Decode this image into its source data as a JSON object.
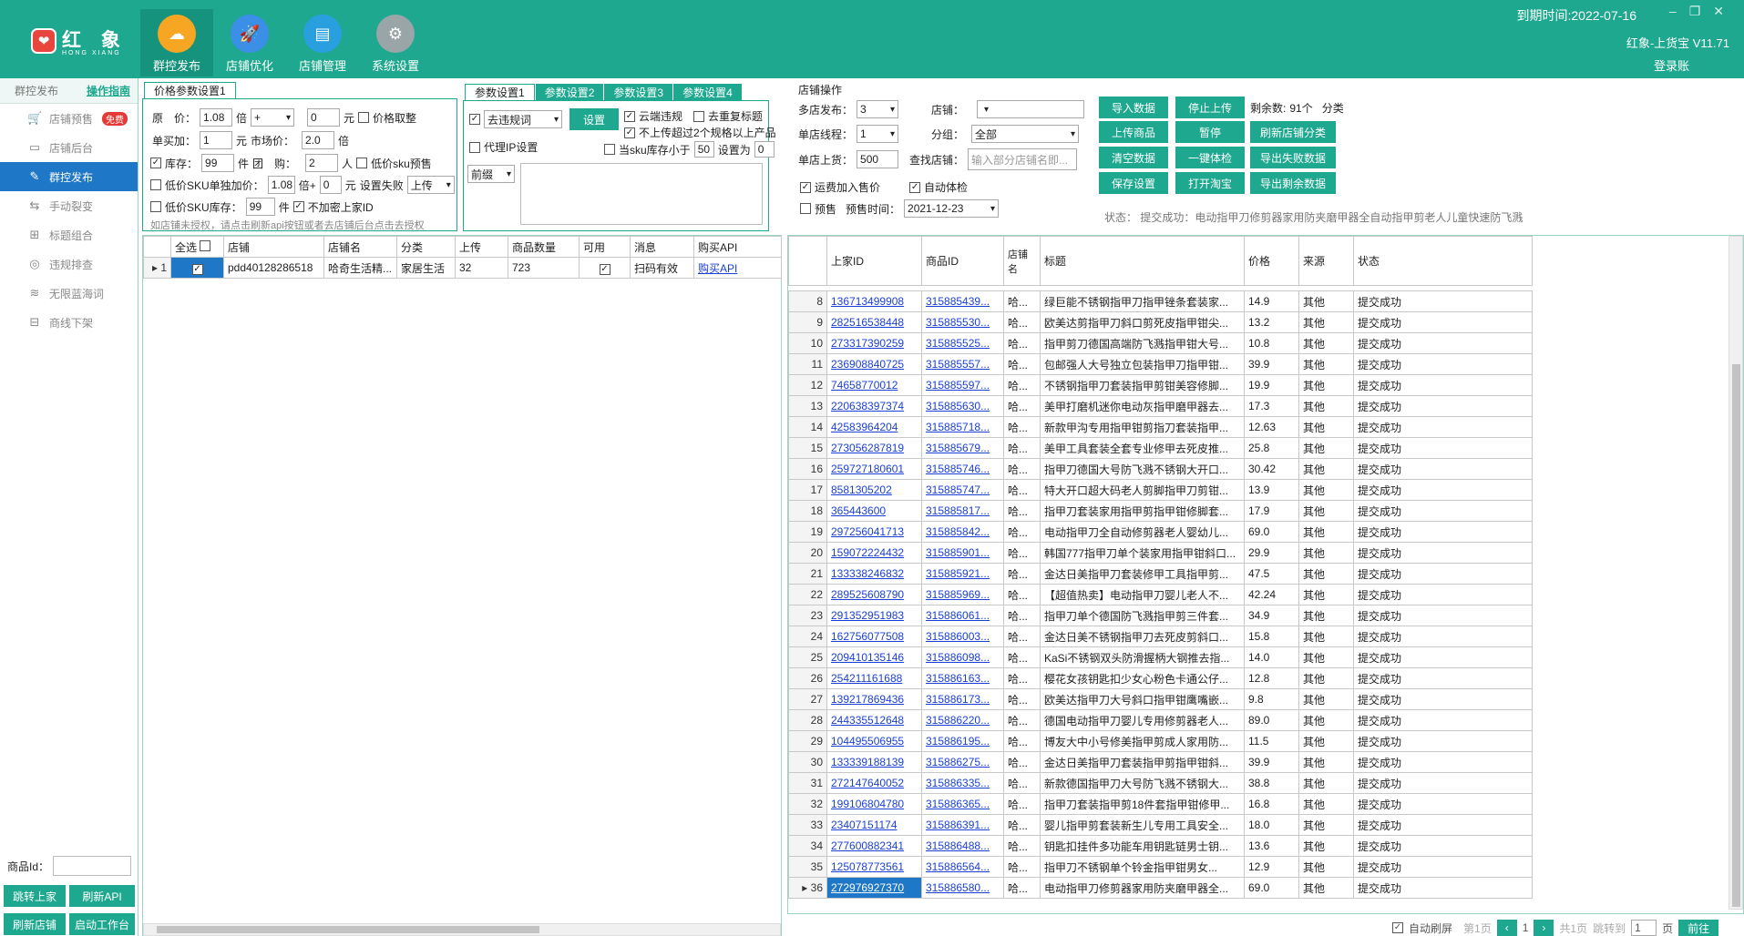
{
  "app": {
    "logo_mark": "❤",
    "logo_text": "红 象",
    "logo_sub": "HONG XIANG",
    "expire": "到期时间:2022-07-16",
    "version": "红象-上货宝 V11.71",
    "login": "登录账"
  },
  "nav": [
    {
      "label": "群控发布",
      "icon": "☁"
    },
    {
      "label": "店铺优化",
      "icon": "🚀"
    },
    {
      "label": "店铺管理",
      "icon": "▤"
    },
    {
      "label": "系统设置",
      "icon": "⚙"
    }
  ],
  "sidebar": {
    "title": "群控发布",
    "guide": "操作指南",
    "items": [
      {
        "label": "店铺预售",
        "icon": "🛒",
        "badge": "免费"
      },
      {
        "label": "店铺后台",
        "icon": "▭"
      },
      {
        "label": "群控发布",
        "icon": "✎"
      },
      {
        "label": "手动裂变",
        "icon": "⇆"
      },
      {
        "label": "标题组合",
        "icon": "⊞"
      },
      {
        "label": "违规排查",
        "icon": "◎"
      },
      {
        "label": "无限蓝海词",
        "icon": "≋"
      },
      {
        "label": "商线下架",
        "icon": "⊟"
      }
    ],
    "pid_label": "商品Id：",
    "btns": [
      "跳转上家",
      "刷新API",
      "刷新店铺",
      "启动工作台"
    ]
  },
  "price": {
    "tab": "价格参数设置1",
    "orig_label": "原　价：",
    "orig": "1.08",
    "bei": "倍",
    "op": "+",
    "add": "0",
    "yuan": "元",
    "round": "价格取整",
    "buy_label": "单买加：",
    "buy": "1",
    "yuan2": "元",
    "market_label": "市场价：",
    "market": "2.0",
    "bei2": "倍",
    "stock_label": "库存：",
    "stock": "99",
    "jian": "件",
    "group_label": "团　购：",
    "group": "2",
    "ren": "人",
    "low_sku": "低价sku预售",
    "low_add_label": "低价SKU单独加价：",
    "low_add": "1.08",
    "bei3": "倍+",
    "low_add2": "0",
    "yuan3": "元",
    "fail_label": "设置失败",
    "fail_val": "上传",
    "low_stock_label": "低价SKU库存：",
    "low_stock": "99",
    "jian2": "件",
    "noencrypt": "不加密上家ID",
    "note": "如店铺未授权，请点击刷新api按钮或者去店铺后台点击去授权"
  },
  "params": {
    "tabs": [
      "参数设置1",
      "参数设置2",
      "参数设置3",
      "参数设置4"
    ],
    "rule": "去违规词",
    "set": "设置",
    "cloud": "云端违规",
    "dedupe": "去重复标题",
    "no_spec": "不上传超过2个规格以上产品",
    "proxy": "代理IP设置",
    "sku_lt": "当sku库存小于",
    "sku_n": "50",
    "set_to": "设置为",
    "set_n": "0",
    "prefix": "前缀"
  },
  "shopop": {
    "title": "店铺操作",
    "multi_label": "多店发布：",
    "multi": "3",
    "shop_label": "店铺：",
    "shop": "",
    "thread_label": "单店线程：",
    "thread": "1",
    "group_label": "分组：",
    "group": "全部",
    "goods_label": "单店上货：",
    "goods": "500",
    "find_label": "查找店铺：",
    "find_ph": "输入部分店铺名即...",
    "freight": "运费加入售价",
    "autocheck": "自动体检",
    "presale": "预售",
    "presale_time_label": "预售时间：",
    "presale_time": "2021-12-23",
    "btns": [
      "导入数据",
      "上传商品",
      "清空数据",
      "保存设置",
      "停止上传",
      "暂停",
      "一键体检",
      "打开淘宝",
      "刷新店铺分类",
      "导出失败数据",
      "导出剩余数据"
    ],
    "remain_label": "剩余数:",
    "remain": "91个",
    "fen": "分类",
    "status": "状态：  提交成功：电动指甲刀修剪器家用防夹磨甲器全自动指甲剪老人儿童快速防飞溅"
  },
  "shoptable": {
    "headers": [
      "全选",
      "店铺",
      "店铺名",
      "分类",
      "上传",
      "商品数量",
      "可用",
      "消息",
      "购买API"
    ],
    "rows": [
      {
        "n": "1",
        "shop": "pdd40128286518",
        "name": "哈奇生活精...",
        "cat": "家居生活",
        "up": "32",
        "count": "723",
        "msg": "扫码有效",
        "api": "购买API"
      }
    ]
  },
  "goods": {
    "headers": [
      "上家ID",
      "商品ID",
      "店铺名",
      "标题",
      "价格",
      "来源",
      "状态"
    ],
    "rows": [
      [
        "8",
        "136713499908",
        "315885439...",
        "哈...",
        "绿巨能不锈钢指甲刀指甲锉条套装家...",
        "14.9",
        "其他",
        "提交成功"
      ],
      [
        "9",
        "282516538448",
        "315885530...",
        "哈...",
        "欧美达剪指甲刀斜口剪死皮指甲钳尖...",
        "13.2",
        "其他",
        "提交成功"
      ],
      [
        "10",
        "273317390259",
        "315885525...",
        "哈...",
        "指甲剪刀德国高端防飞溅指甲钳大号...",
        "10.8",
        "其他",
        "提交成功"
      ],
      [
        "11",
        "236908840725",
        "315885557...",
        "哈...",
        "包邮强人大号独立包装指甲刀指甲钳...",
        "39.9",
        "其他",
        "提交成功"
      ],
      [
        "12",
        "74658770012",
        "315885597...",
        "哈...",
        "不锈钢指甲刀套装指甲剪钳美容修脚...",
        "19.9",
        "其他",
        "提交成功"
      ],
      [
        "13",
        "220638397374",
        "315885630...",
        "哈...",
        "美甲打磨机迷你电动灰指甲磨甲器去...",
        "17.3",
        "其他",
        "提交成功"
      ],
      [
        "14",
        "42583964204",
        "315885718...",
        "哈...",
        "新款甲沟专用指甲钳剪指刀套装指甲...",
        "12.63",
        "其他",
        "提交成功"
      ],
      [
        "15",
        "273056287819",
        "315885679...",
        "哈...",
        "美甲工具套装全套专业修甲去死皮推...",
        "25.8",
        "其他",
        "提交成功"
      ],
      [
        "16",
        "259727180601",
        "315885746...",
        "哈...",
        "指甲刀德国大号防飞溅不锈钢大开口...",
        "30.42",
        "其他",
        "提交成功"
      ],
      [
        "17",
        "8581305202",
        "315885747...",
        "哈...",
        "特大开口超大码老人剪脚指甲刀剪钳...",
        "13.9",
        "其他",
        "提交成功"
      ],
      [
        "18",
        "365443600",
        "315885817...",
        "哈...",
        "指甲刀套装家用指甲剪指甲钳修脚套...",
        "17.9",
        "其他",
        "提交成功"
      ],
      [
        "19",
        "297256041713",
        "315885842...",
        "哈...",
        "电动指甲刀全自动修剪器老人婴幼儿...",
        "69.0",
        "其他",
        "提交成功"
      ],
      [
        "20",
        "159072224432",
        "315885901...",
        "哈...",
        "韩国777指甲刀单个装家用指甲钳斜口...",
        "29.9",
        "其他",
        "提交成功"
      ],
      [
        "21",
        "133338246832",
        "315885921...",
        "哈...",
        "金达日美指甲刀套装修甲工具指甲剪...",
        "47.5",
        "其他",
        "提交成功"
      ],
      [
        "22",
        "289525608790",
        "315885969...",
        "哈...",
        "【超值热卖】电动指甲刀婴儿老人不...",
        "42.24",
        "其他",
        "提交成功"
      ],
      [
        "23",
        "291352951983",
        "315886061...",
        "哈...",
        "指甲刀单个德国防飞溅指甲剪三件套...",
        "34.9",
        "其他",
        "提交成功"
      ],
      [
        "24",
        "162756077508",
        "315886003...",
        "哈...",
        "金达日美不锈钢指甲刀去死皮剪斜口...",
        "15.8",
        "其他",
        "提交成功"
      ],
      [
        "25",
        "209410135146",
        "315886098...",
        "哈...",
        "KaSi不锈钢双头防滑握柄大钢推去指...",
        "14.0",
        "其他",
        "提交成功"
      ],
      [
        "26",
        "254211161688",
        "315886163...",
        "哈...",
        "樱花女孩钥匙扣少女心粉色卡通公仔...",
        "12.8",
        "其他",
        "提交成功"
      ],
      [
        "27",
        "139217869436",
        "315886173...",
        "哈...",
        "欧美达指甲刀大号斜口指甲钳鹰嘴嵌...",
        "9.8",
        "其他",
        "提交成功"
      ],
      [
        "28",
        "244335512648",
        "315886220...",
        "哈...",
        "德国电动指甲刀婴儿专用修剪器老人...",
        "89.0",
        "其他",
        "提交成功"
      ],
      [
        "29",
        "104495506955",
        "315886195...",
        "哈...",
        "博友大中小号修美指甲剪成人家用防...",
        "11.5",
        "其他",
        "提交成功"
      ],
      [
        "30",
        "133339188139",
        "315886275...",
        "哈...",
        "金达日美指甲刀套装指甲剪指甲钳斜...",
        "39.9",
        "其他",
        "提交成功"
      ],
      [
        "31",
        "272147640052",
        "315886335...",
        "哈...",
        "新款德国指甲刀大号防飞溅不锈钢大...",
        "38.8",
        "其他",
        "提交成功"
      ],
      [
        "32",
        "199106804780",
        "315886365...",
        "哈...",
        "指甲刀套装指甲剪18件套指甲钳修甲...",
        "16.8",
        "其他",
        "提交成功"
      ],
      [
        "33",
        "23407151174",
        "315886391...",
        "哈...",
        "婴儿指甲剪套装新生儿专用工具安全...",
        "18.0",
        "其他",
        "提交成功"
      ],
      [
        "34",
        "277600882341",
        "315886488...",
        "哈...",
        "钥匙扣挂件多功能车用钥匙链男士钥...",
        "13.6",
        "其他",
        "提交成功"
      ],
      [
        "35",
        "125078773561",
        "315886564...",
        "哈...",
        "指甲刀不锈钢单个铃金指甲钳男女...",
        "12.9",
        "其他",
        "提交成功"
      ],
      [
        "36",
        "272976927370",
        "315886580...",
        "哈...",
        "电动指甲刀修剪器家用防夹磨甲器全...",
        "69.0",
        "其他",
        "提交成功"
      ]
    ]
  },
  "pager": {
    "auto": "自动刷屏",
    "first": "第1页",
    "cur": "1",
    "total": "共1页",
    "jump": "跳转到",
    "jump_val": "1",
    "page": "页",
    "go": "前往"
  }
}
